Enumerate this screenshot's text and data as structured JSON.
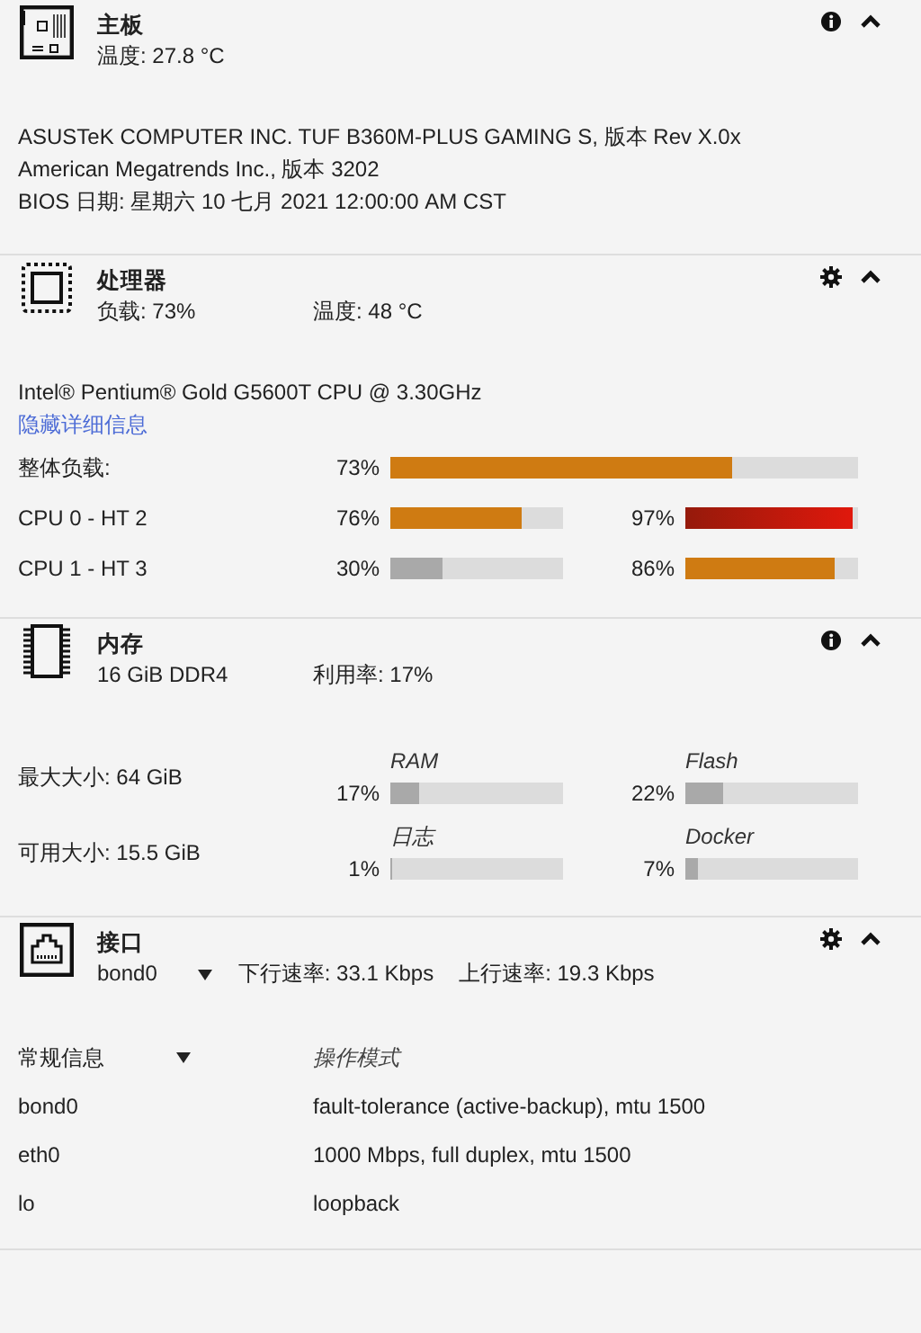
{
  "motherboard": {
    "title": "主板",
    "summary": [
      "温度: 27.8 °C"
    ],
    "actions": [
      {
        "kind": "info"
      },
      {
        "kind": "collapse"
      }
    ],
    "lines": [
      "ASUSTeK COMPUTER INC. TUF B360M-PLUS GAMING S, 版本 Rev X.0x",
      "American Megatrends Inc., 版本 3202",
      "BIOS 日期: 星期六 10 七月 2021 12:00:00 AM CST"
    ]
  },
  "processor": {
    "title": "处理器",
    "summary": [
      "负载: 73%",
      "温度: 48 °C"
    ],
    "actions": [
      {
        "kind": "settings"
      },
      {
        "kind": "collapse"
      }
    ],
    "lines": [
      "Intel® Pentium® Gold G5600T CPU @ 3.30GHz"
    ],
    "link": "隐藏详细信息",
    "overall": {
      "label": "整体负载:",
      "reading": "73%",
      "level": 0.73
    },
    "threads": [
      {
        "label": "CPU 0 - HT 2",
        "meters": [
          {
            "reading": "76%",
            "level": 0.76
          },
          {
            "reading": "97%",
            "level": 0.97
          }
        ]
      },
      {
        "label": "CPU 1 - HT 3",
        "meters": [
          {
            "reading": "30%",
            "level": 0.3
          },
          {
            "reading": "86%",
            "level": 0.86
          }
        ]
      }
    ]
  },
  "memory": {
    "title": "内存",
    "summary": [
      "16 GiB DDR4",
      "利用率: 17%"
    ],
    "actions": [
      {
        "kind": "info"
      },
      {
        "kind": "collapse"
      }
    ],
    "sizes": [
      {
        "label": "最大大小: 64 GiB",
        "meters": [
          {
            "name": "RAM",
            "reading": "17%",
            "level": 0.17
          },
          {
            "name": "Flash",
            "reading": "22%",
            "level": 0.22
          }
        ]
      },
      {
        "label": "可用大小: 15.5 GiB",
        "meters": [
          {
            "name": "日志",
            "reading": "1%",
            "level": 0.01
          },
          {
            "name": "Docker",
            "reading": "7%",
            "level": 0.07
          }
        ]
      }
    ]
  },
  "interfaces": {
    "title": "接口",
    "selector": "bond0",
    "summary": [
      "下行速率: 33.1 Kbps",
      "上行速率: 19.3 Kbps"
    ],
    "actions": [
      {
        "kind": "settings"
      },
      {
        "kind": "collapse"
      }
    ],
    "view_selector": "常规信息",
    "column_header": "操作模式",
    "rows": [
      {
        "name": "bond0",
        "mode": "fault-tolerance (active-backup), mtu 1500"
      },
      {
        "name": "eth0",
        "mode": "1000 Mbps, full duplex, mtu 1500"
      },
      {
        "name": "lo",
        "mode": "loopback"
      }
    ]
  }
}
